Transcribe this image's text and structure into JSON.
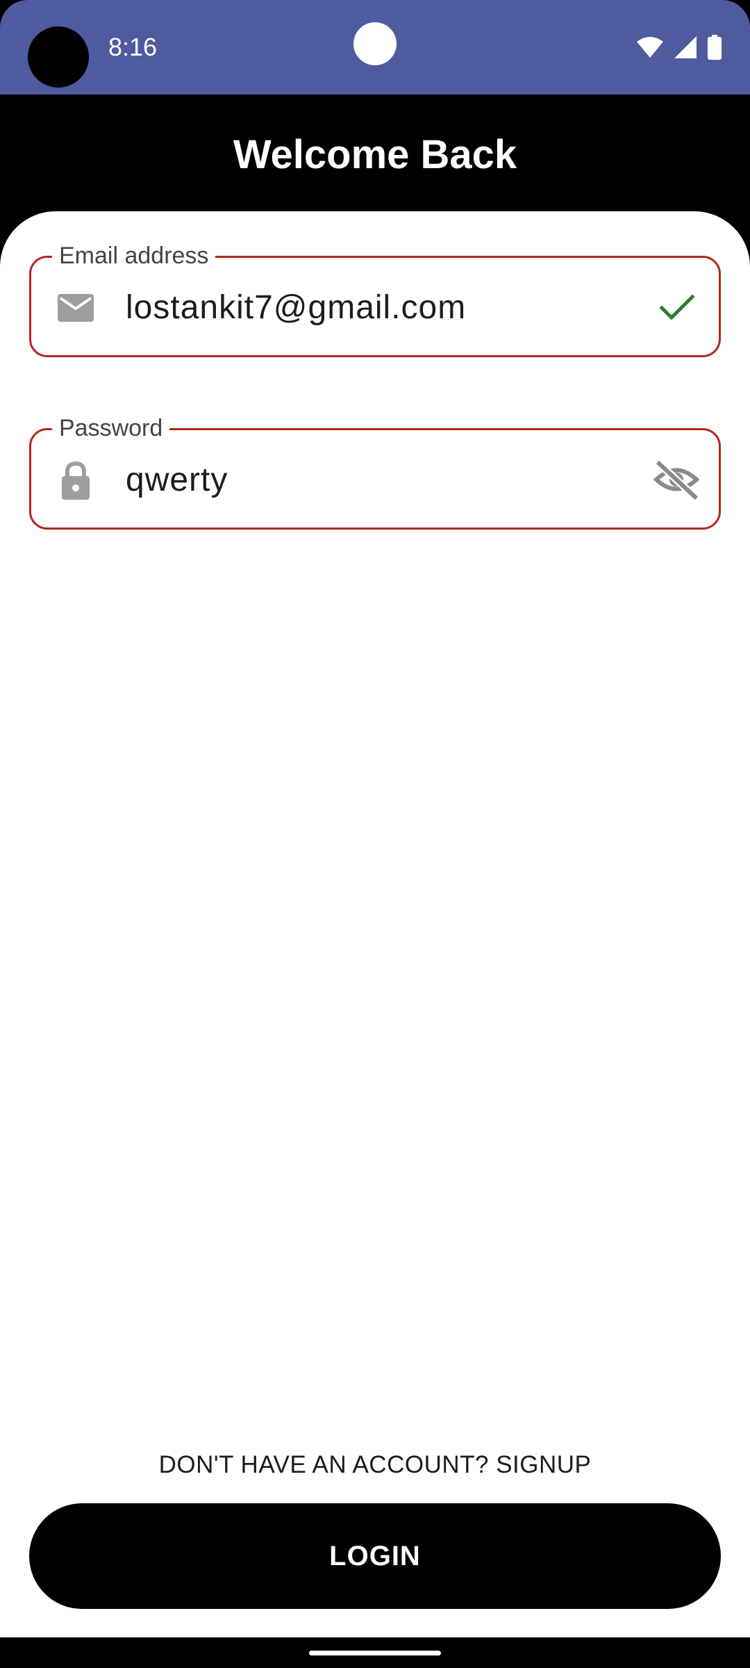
{
  "status_bar": {
    "time": "8:16",
    "bg_color": "#4e5b9e",
    "icons": [
      "wifi-icon",
      "cellular-signal-icon",
      "battery-icon"
    ]
  },
  "header": {
    "title": "Welcome Back"
  },
  "form": {
    "email": {
      "label": "Email address",
      "value": "lostankit7@gmail.com",
      "lead_icon": "mail-icon",
      "trail_icon": "check-icon"
    },
    "password": {
      "label": "Password",
      "value": "qwerty",
      "lead_icon": "lock-icon",
      "trail_icon": "visibility-off-icon"
    },
    "outline_color": "#b3261e"
  },
  "signup": {
    "label": "DON'T HAVE AN ACCOUNT? SIGNUP"
  },
  "login_button": {
    "label": "LOGIN"
  }
}
